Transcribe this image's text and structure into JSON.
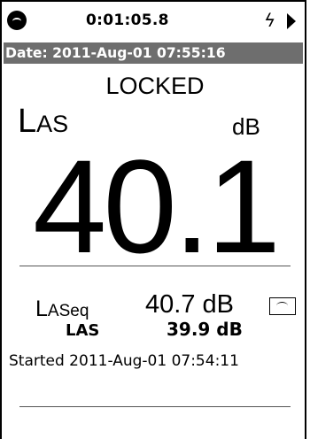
{
  "status": {
    "elapsed_time": "0:01:05.8",
    "icons": [
      "status-circle-icon",
      "power-bolt-icon",
      "play-arrow-icon"
    ]
  },
  "date_bar": {
    "text": "Date: 2011-Aug-01 07:55:16"
  },
  "lock_state": "LOCKED",
  "metric": {
    "label_main": "L",
    "label_sub": "AS",
    "unit": "dB",
    "value": "40.1"
  },
  "readings": [
    {
      "label_main": "L",
      "label_sub": "ASeq",
      "value": "40.7 dB"
    },
    {
      "label": "LAS",
      "value": "39.9 dB"
    }
  ],
  "started": "Started 2011-Aug-01 07:54:11",
  "colors": {
    "date_bar_bg": "#6e6e6e",
    "text": "#000000",
    "background": "#ffffff"
  }
}
